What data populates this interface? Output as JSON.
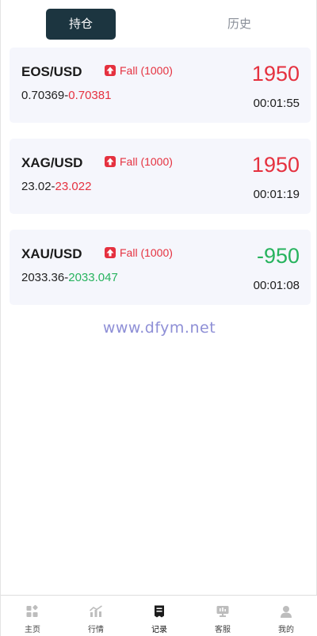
{
  "tabs": {
    "active_label": "持仓",
    "history_label": "历史"
  },
  "positions": [
    {
      "symbol": "EOS/USD",
      "direction": "Fall (1000)",
      "open_price": "0.70369",
      "separator": "-",
      "current_price": "0.70381",
      "pnl": "1950",
      "timer": "00:01:55"
    },
    {
      "symbol": "XAG/USD",
      "direction": "Fall (1000)",
      "open_price": "23.02",
      "separator": "-",
      "current_price": "23.022",
      "pnl": "1950",
      "timer": "00:01:19"
    },
    {
      "symbol": "XAU/USD",
      "direction": "Fall (1000)",
      "open_price": "2033.36",
      "separator": "-",
      "current_price": "2033.047",
      "pnl": "-950",
      "timer": "00:01:08"
    }
  ],
  "watermark": "www.dfym.net",
  "nav": {
    "home": "主页",
    "market": "行情",
    "records": "记录",
    "service": "客服",
    "mine": "我的"
  },
  "colors": {
    "profit": "#e5313f",
    "loss": "#27b35e",
    "tab_active_bg": "#1c3540"
  }
}
